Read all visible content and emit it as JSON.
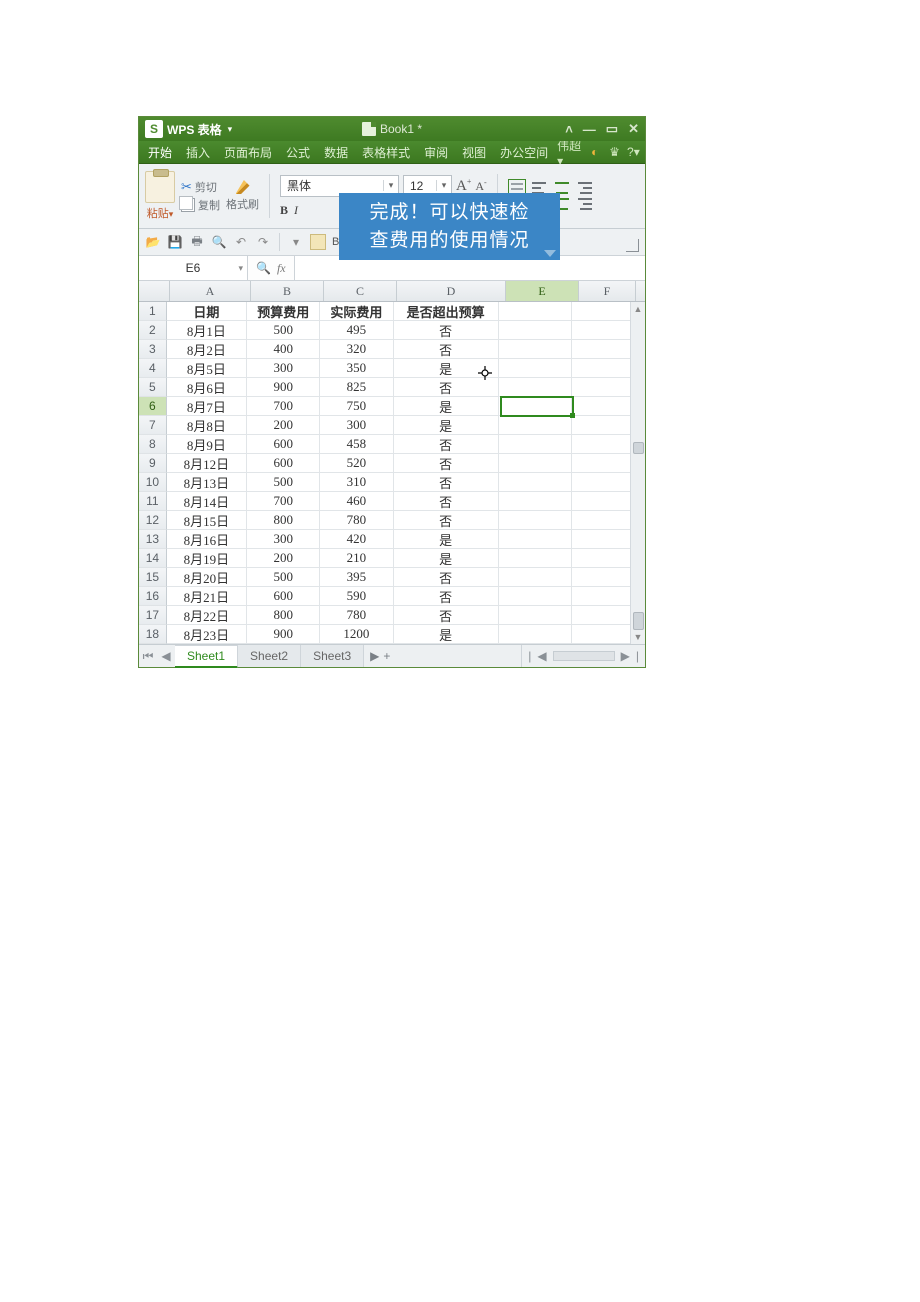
{
  "titlebar": {
    "logo_text": "S",
    "app_name": "WPS 表格",
    "doc_name": "Book1 *"
  },
  "menus": {
    "items": [
      "开始",
      "插入",
      "页面布局",
      "公式",
      "数据",
      "表格样式",
      "审阅",
      "视图",
      "办公空间"
    ],
    "user": "伟超"
  },
  "ribbon": {
    "paste": "粘贴",
    "cut": "剪切",
    "copy": "复制",
    "format_painter": "格式刷",
    "font_name": "黑体",
    "font_size": "12",
    "bold": "B",
    "italic": "I",
    "aa_big": "A",
    "aa_small": "A",
    "book_label": "Bo"
  },
  "formula_bar": {
    "namebox": "E6",
    "zoom_glyph": "🔍",
    "fx": "fx"
  },
  "tooltip": {
    "line1": "完成！可以快速检",
    "line2": "查费用的使用情况"
  },
  "columns": [
    "A",
    "B",
    "C",
    "D",
    "E",
    "F"
  ],
  "table": {
    "headers": {
      "A": "日期",
      "B": "预算费用",
      "C": "实际费用",
      "D": "是否超出预算"
    },
    "rows": [
      {
        "n": 1,
        "A": "日期",
        "B": "预算费用",
        "C": "实际费用",
        "D": "是否超出预算",
        "header": true
      },
      {
        "n": 2,
        "A": "8月1日",
        "B": "500",
        "C": "495",
        "D": "否"
      },
      {
        "n": 3,
        "A": "8月2日",
        "B": "400",
        "C": "320",
        "D": "否"
      },
      {
        "n": 4,
        "A": "8月5日",
        "B": "300",
        "C": "350",
        "D": "是"
      },
      {
        "n": 5,
        "A": "8月6日",
        "B": "900",
        "C": "825",
        "D": "否"
      },
      {
        "n": 6,
        "A": "8月7日",
        "B": "700",
        "C": "750",
        "D": "是"
      },
      {
        "n": 7,
        "A": "8月8日",
        "B": "200",
        "C": "300",
        "D": "是"
      },
      {
        "n": 8,
        "A": "8月9日",
        "B": "600",
        "C": "458",
        "D": "否"
      },
      {
        "n": 9,
        "A": "8月12日",
        "B": "600",
        "C": "520",
        "D": "否"
      },
      {
        "n": 10,
        "A": "8月13日",
        "B": "500",
        "C": "310",
        "D": "否"
      },
      {
        "n": 11,
        "A": "8月14日",
        "B": "700",
        "C": "460",
        "D": "否"
      },
      {
        "n": 12,
        "A": "8月15日",
        "B": "800",
        "C": "780",
        "D": "否"
      },
      {
        "n": 13,
        "A": "8月16日",
        "B": "300",
        "C": "420",
        "D": "是"
      },
      {
        "n": 14,
        "A": "8月19日",
        "B": "200",
        "C": "210",
        "D": "是"
      },
      {
        "n": 15,
        "A": "8月20日",
        "B": "500",
        "C": "395",
        "D": "否"
      },
      {
        "n": 16,
        "A": "8月21日",
        "B": "600",
        "C": "590",
        "D": "否"
      },
      {
        "n": 17,
        "A": "8月22日",
        "B": "800",
        "C": "780",
        "D": "否"
      },
      {
        "n": 18,
        "A": "8月23日",
        "B": "900",
        "C": "1200",
        "D": "是"
      }
    ]
  },
  "selected": {
    "row_index": 6,
    "col": "E"
  },
  "sheets": {
    "tabs": [
      "Sheet1",
      "Sheet2",
      "Sheet3"
    ],
    "active": 0,
    "more": "▶",
    "add": "+"
  }
}
